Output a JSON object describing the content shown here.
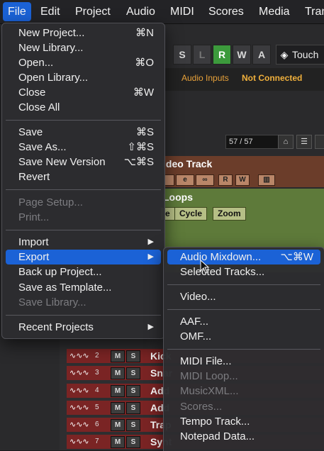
{
  "menubar": {
    "items": [
      "File",
      "Edit",
      "Project",
      "Audio",
      "MIDI",
      "Scores",
      "Media",
      "Tran"
    ]
  },
  "toolbar": {
    "mode_buttons": [
      "S",
      "L",
      "R",
      "W",
      "A"
    ],
    "touch_label": "Touch",
    "audio_inputs_label": "Audio Inputs",
    "connection_status": "Not Connected",
    "track_counter": "57 / 57"
  },
  "tracks": {
    "video_track": "ideo Track",
    "video_buttons": [
      "",
      "e",
      "",
      "R",
      "W",
      ""
    ],
    "loops_track": "Loops",
    "loops_buttons": [
      "e",
      "Cycle",
      "Zoom"
    ],
    "rows": [
      {
        "num": "2",
        "name": "Kick"
      },
      {
        "num": "3",
        "name": "Snar"
      },
      {
        "num": "4",
        "name": "Add"
      },
      {
        "num": "5",
        "name": "Add"
      },
      {
        "num": "6",
        "name": "Trap"
      },
      {
        "num": "7",
        "name": "Synt"
      }
    ]
  },
  "file_menu": {
    "items": [
      {
        "label": "New Project...",
        "shortcut": "⌘N"
      },
      {
        "label": "New Library..."
      },
      {
        "label": "Open...",
        "shortcut": "⌘O"
      },
      {
        "label": "Open Library..."
      },
      {
        "label": "Close",
        "shortcut": "⌘W"
      },
      {
        "label": "Close All"
      },
      {
        "label": "Save",
        "shortcut": "⌘S"
      },
      {
        "label": "Save As...",
        "shortcut": "⇧⌘S"
      },
      {
        "label": "Save New Version",
        "shortcut": "⌥⌘S"
      },
      {
        "label": "Revert"
      },
      {
        "label": "Page Setup...",
        "disabled": true
      },
      {
        "label": "Print...",
        "disabled": true
      },
      {
        "label": "Import"
      },
      {
        "label": "Export"
      },
      {
        "label": "Back up Project..."
      },
      {
        "label": "Save as Template..."
      },
      {
        "label": "Save Library...",
        "disabled": true
      },
      {
        "label": "Recent Projects"
      }
    ]
  },
  "export_menu": {
    "items": [
      {
        "label": "Audio Mixdown...",
        "shortcut": "⌥⌘W"
      },
      {
        "label": "Selected Tracks..."
      },
      {
        "label": "Video..."
      },
      {
        "label": "AAF..."
      },
      {
        "label": "OMF..."
      },
      {
        "label": "MIDI File..."
      },
      {
        "label": "MIDI Loop...",
        "disabled": true
      },
      {
        "label": "MusicXML...",
        "disabled": true
      },
      {
        "label": "Scores...",
        "disabled": true
      },
      {
        "label": "Tempo Track..."
      },
      {
        "label": "Notepad Data..."
      }
    ]
  },
  "colors": {
    "accent": "#1b62d6",
    "recording_green": "#3c9a3c",
    "status_orange": "#f0b03c"
  }
}
